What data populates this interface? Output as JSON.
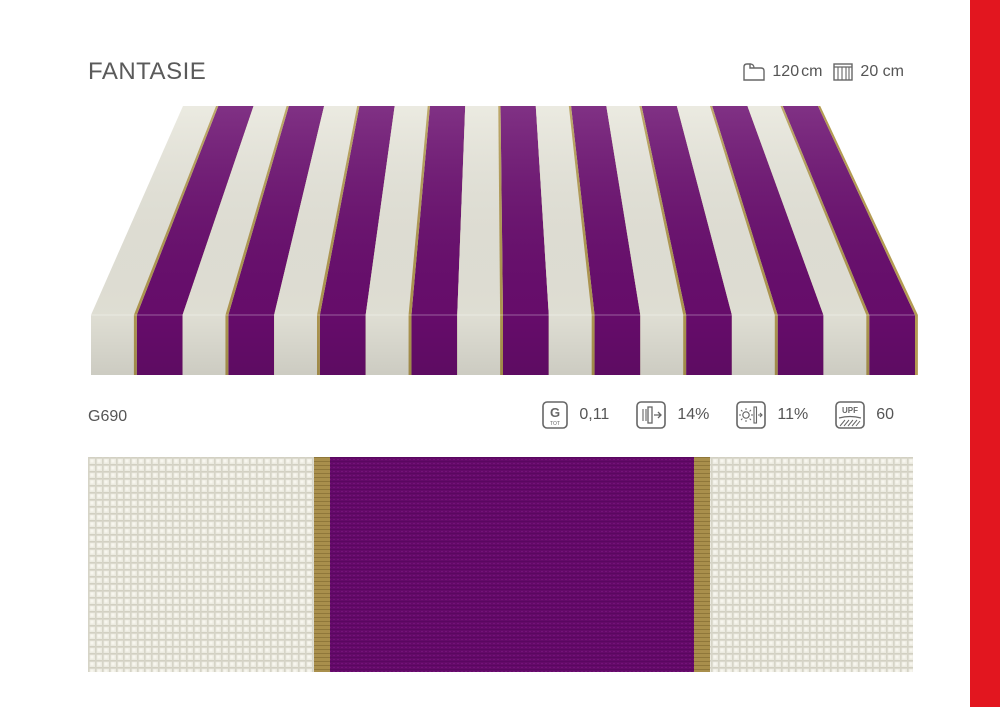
{
  "header": {
    "title": "FANTASIE",
    "width": {
      "icon": "roll-width-icon",
      "value": "120",
      "unit": "cm"
    },
    "repeat": {
      "icon": "stripe-repeat-icon",
      "value": "20 cm"
    }
  },
  "sample_code": "G690",
  "properties": [
    {
      "icon": "gtot-icon",
      "icon_text": "G",
      "icon_subtext": "TOT",
      "value": "0,11"
    },
    {
      "icon": "thermal-transmission-icon",
      "value": "14%"
    },
    {
      "icon": "light-transmission-icon",
      "value": "11%"
    },
    {
      "icon": "upf-icon",
      "icon_text": "UPF",
      "value": "60"
    }
  ],
  "colors": {
    "accent_bar": "#e2161f",
    "stripe_purple": "#6a0d6f",
    "stripe_cream": "#e8e7dc",
    "stripe_gold": "#b39b52"
  }
}
